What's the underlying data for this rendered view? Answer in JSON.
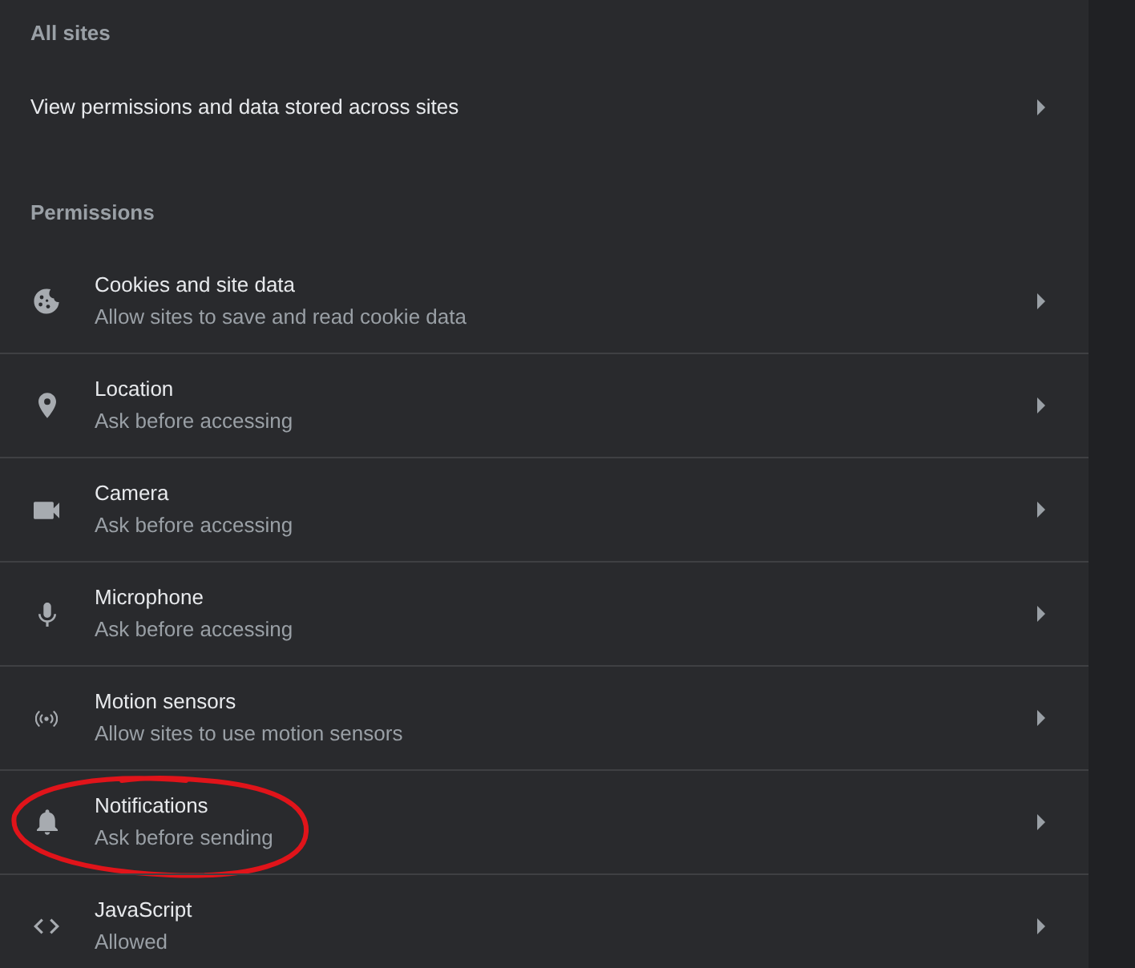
{
  "all_sites": {
    "heading": "All sites",
    "link": {
      "label": "View permissions and data stored across sites"
    }
  },
  "permissions": {
    "heading": "Permissions",
    "items": [
      {
        "kind": "cookies",
        "title": "Cookies and site data",
        "description": "Allow sites to save and read cookie data",
        "circled": false
      },
      {
        "kind": "location",
        "title": "Location",
        "description": "Ask before accessing",
        "circled": false
      },
      {
        "kind": "camera",
        "title": "Camera",
        "description": "Ask before accessing",
        "circled": false
      },
      {
        "kind": "microphone",
        "title": "Microphone",
        "description": "Ask before accessing",
        "circled": false
      },
      {
        "kind": "motion",
        "title": "Motion sensors",
        "description": "Allow sites to use motion sensors",
        "circled": false
      },
      {
        "kind": "notifications",
        "title": "Notifications",
        "description": "Ask before sending",
        "circled": true
      },
      {
        "kind": "javascript",
        "title": "JavaScript",
        "description": "Allowed",
        "circled": false
      }
    ]
  }
}
